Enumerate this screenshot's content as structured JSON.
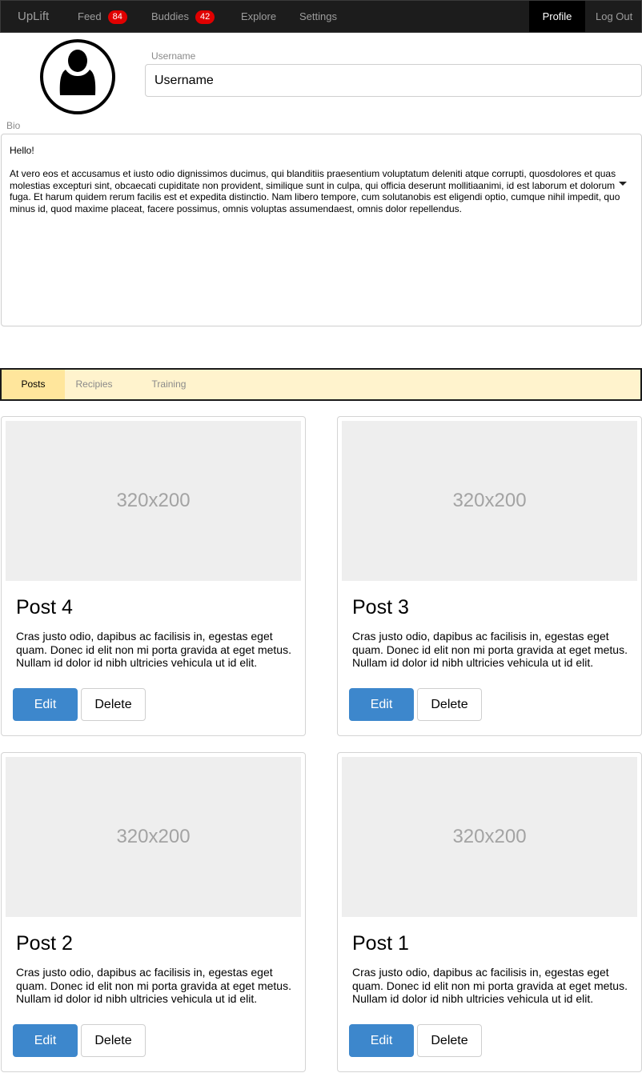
{
  "navbar": {
    "brand": "UpLift",
    "items": [
      {
        "label": "Feed",
        "badge": "84"
      },
      {
        "label": "Buddies",
        "badge": "42"
      },
      {
        "label": "Explore"
      },
      {
        "label": "Settings"
      }
    ],
    "profile_label": "Profile",
    "logout_label": "Log Out"
  },
  "profile": {
    "avatar_icon": "person-silhouette-icon",
    "username_label": "Username",
    "username_value": "Username",
    "bio_label": "Bio",
    "bio_text": "Hello!\n\nAt vero eos et accusamus et iusto odio dignissimos ducimus, qui blanditiis praesentium voluptatum deleniti atque corrupti, quosdolores et quas molestias excepturi sint, obcaecati cupiditate non provident, similique sunt in culpa, qui officia deserunt mollitiaanimi, id est laborum et dolorum fuga. Et harum quidem rerum facilis est et expedita distinctio. Nam libero tempore, cum solutanobis est eligendi optio, cumque nihil impedit, quo minus id, quod maxime placeat, facere possimus, omnis voluptas assumendaest, omnis dolor repellendus."
  },
  "tabs": [
    {
      "label": "Posts",
      "active": true
    },
    {
      "label": "Recipies",
      "active": false
    },
    {
      "label": "Training",
      "active": false
    }
  ],
  "posts": [
    {
      "image_placeholder": "320x200",
      "title": "Post 4",
      "text": "Cras justo odio, dapibus ac facilisis in, egestas eget quam. Donec id elit non mi porta gravida at eget metus. Nullam id dolor id nibh ultricies vehicula ut id elit.",
      "edit_label": "Edit",
      "delete_label": "Delete"
    },
    {
      "image_placeholder": "320x200",
      "title": "Post 3",
      "text": "Cras justo odio, dapibus ac facilisis in, egestas eget quam. Donec id elit non mi porta gravida at eget metus. Nullam id dolor id nibh ultricies vehicula ut id elit.",
      "edit_label": "Edit",
      "delete_label": "Delete"
    },
    {
      "image_placeholder": "320x200",
      "title": "Post 2",
      "text": "Cras justo odio, dapibus ac facilisis in, egestas eget quam. Donec id elit non mi porta gravida at eget metus. Nullam id dolor id nibh ultricies vehicula ut id elit.",
      "edit_label": "Edit",
      "delete_label": "Delete"
    },
    {
      "image_placeholder": "320x200",
      "title": "Post 1",
      "text": "Cras justo odio, dapibus ac facilisis in, egestas eget quam. Donec id elit non mi porta gravida at eget metus. Nullam id dolor id nibh ultricies vehicula ut id elit.",
      "edit_label": "Edit",
      "delete_label": "Delete"
    }
  ],
  "colors": {
    "navbar_bg": "#1c1c1c",
    "badge": "#e00000",
    "tabs_bg": "#fff3cd",
    "tab_active_bg": "#ffe69c",
    "edit_button": "#3d87cc"
  }
}
